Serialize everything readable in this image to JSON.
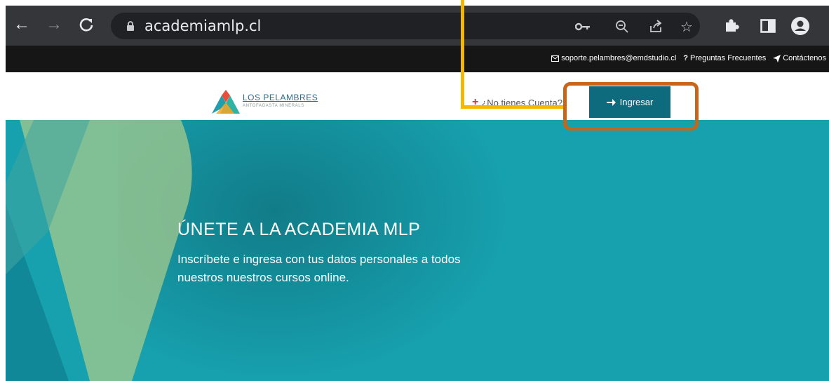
{
  "browser": {
    "url": "academiamlp.cl",
    "nav_icons": [
      "back-arrow-icon",
      "forward-arrow-icon",
      "reload-icon"
    ],
    "omnibox_icons": [
      "key-icon",
      "zoom-icon",
      "share-icon",
      "star-icon"
    ],
    "toolbar_icons": [
      "extensions-icon",
      "sidepanel-icon",
      "profile-icon"
    ]
  },
  "topbar": {
    "email": "soporte.pelambres@emdstudio.cl",
    "faq": "Preguntas Frecuentes",
    "contact": "Contáctenos"
  },
  "header": {
    "logo_name": "LOS PELAMBRES",
    "logo_sub": "ANTOFAGASTA MINERALS",
    "signup_text": "¿No tienes Cuenta?",
    "login_label": "Ingresar"
  },
  "hero": {
    "title": "ÚNETE A LA ACADEMIA MLP",
    "description": "Inscríbete e ingresa con tus datos personales a todos nuestros nuestros cursos online."
  },
  "colors": {
    "accent": "#0e6b7e",
    "hero_bg": "#17a0ae",
    "annotation_line": "#f5b800",
    "annotation_box": "#c8651b"
  }
}
